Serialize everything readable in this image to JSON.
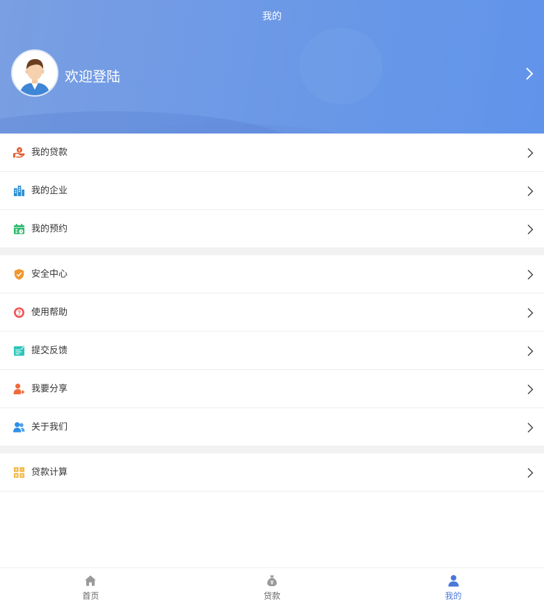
{
  "header": {
    "title": "我的",
    "welcome": "欢迎登陆"
  },
  "menu_groups": [
    [
      {
        "label": "我的贷款",
        "icon": "loan-hand-icon",
        "color": "#e0572a"
      },
      {
        "label": "我的企业",
        "icon": "building-icon",
        "color": "#2a8fd6"
      },
      {
        "label": "我的预约",
        "icon": "calendar-icon",
        "color": "#27b86a"
      }
    ],
    [
      {
        "label": "安全中心",
        "icon": "shield-icon",
        "color": "#f0962e"
      },
      {
        "label": "使用帮助",
        "icon": "help-icon",
        "color": "#f15b5b"
      },
      {
        "label": "提交反馈",
        "icon": "feedback-icon",
        "color": "#2cc6b9"
      },
      {
        "label": "我要分享",
        "icon": "share-user-icon",
        "color": "#ef6b3c"
      },
      {
        "label": "关于我们",
        "icon": "users-icon",
        "color": "#2f8fe8"
      }
    ],
    [
      {
        "label": "贷款计算",
        "icon": "calculator-grid-icon",
        "color": "#f3b33d"
      }
    ]
  ],
  "tabbar": {
    "tabs": [
      {
        "label": "首页",
        "icon": "home-icon",
        "active": false
      },
      {
        "label": "贷款",
        "icon": "money-bag-icon",
        "active": false
      },
      {
        "label": "我的",
        "icon": "person-icon",
        "active": true
      }
    ],
    "active_color": "#4a78d8",
    "inactive_color": "#9a9a9a"
  }
}
